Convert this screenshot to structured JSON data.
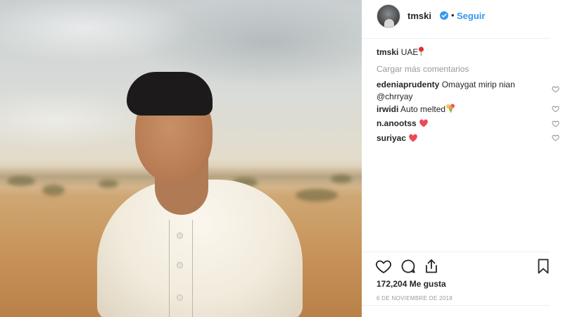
{
  "post": {
    "username": "tmski",
    "follow_label": "Seguir",
    "separator": "•"
  },
  "caption": {
    "user": "tmski",
    "text": "UAE"
  },
  "load_more": "Cargar más comentarios",
  "comments": [
    {
      "user": "edeniaprudenty",
      "text": "Omaygat mirip nian",
      "text2": "@chrryay"
    },
    {
      "user": "irwidi",
      "text": "Auto melted"
    },
    {
      "user": "n.anootss",
      "text": ""
    },
    {
      "user": "suriyac",
      "text": ""
    }
  ],
  "likes": "172,204 Me gusta",
  "date": "6 DE NOVIEMBRE DE 2018",
  "colors": {
    "accent": "#3897f0",
    "muted": "#999999",
    "heart": "#ed4956"
  },
  "icons": [
    "verified-badge-icon",
    "pin-icon",
    "bouquet-icon",
    "heart-emoji-icon",
    "like-heart-icon",
    "comment-icon",
    "share-icon",
    "bookmark-icon"
  ]
}
